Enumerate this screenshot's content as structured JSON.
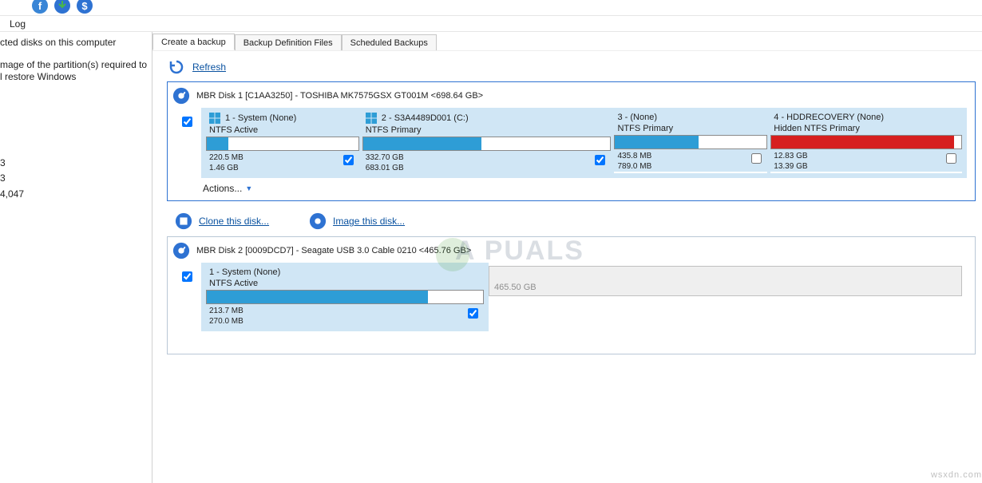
{
  "toolbar": {
    "log": "Log"
  },
  "sidebar": {
    "line1": "cted disks on this computer",
    "line2": "mage of the partition(s) required to",
    "line3": "l restore Windows",
    "frag1": "3",
    "frag2": "3",
    "frag3": "4,047"
  },
  "tabs": [
    {
      "label": "Create a backup"
    },
    {
      "label": "Backup Definition Files"
    },
    {
      "label": "Scheduled Backups"
    }
  ],
  "refresh": "Refresh",
  "disk1": {
    "title": "MBR Disk 1 [C1AA3250] - TOSHIBA MK7575GSX GT001M  <698.64 GB>",
    "parts": [
      {
        "head": "1 - System (None)",
        "sub": "NTFS Active",
        "fillPct": 14,
        "fillClass": "",
        "s1": "220.5 MB",
        "s2": "1.46 GB",
        "chk": true
      },
      {
        "head": "2 - S3A4489D001 (C:)",
        "sub": "NTFS Primary",
        "fillPct": 48,
        "fillClass": "",
        "s1": "332.70 GB",
        "s2": "683.01 GB",
        "chk": true
      },
      {
        "head": "3 -  (None)",
        "sub": "NTFS Primary",
        "fillPct": 55,
        "fillClass": "",
        "s1": "435.8 MB",
        "s2": "789.0 MB",
        "chk": false
      },
      {
        "head": "4 - HDDRECOVERY (None)",
        "sub": "Hidden NTFS Primary",
        "fillPct": 96,
        "fillClass": "red",
        "s1": "12.83 GB",
        "s2": "13.39 GB",
        "chk": false
      }
    ],
    "actions": "Actions..."
  },
  "links": {
    "clone": "Clone this disk...",
    "image": "Image this disk..."
  },
  "disk2": {
    "title": "MBR Disk 2 [0009DCD7] - Seagate  USB 3.0 Cable    0210  <465.76 GB>",
    "part": {
      "head": "1 - System (None)",
      "sub": "NTFS Active",
      "fillPct": 80,
      "s1": "213.7 MB",
      "s2": "270.0 MB",
      "chk": true
    },
    "gray": "465.50 GB"
  },
  "watermark": "wsxdn.com",
  "ghost": "A  PUALS"
}
